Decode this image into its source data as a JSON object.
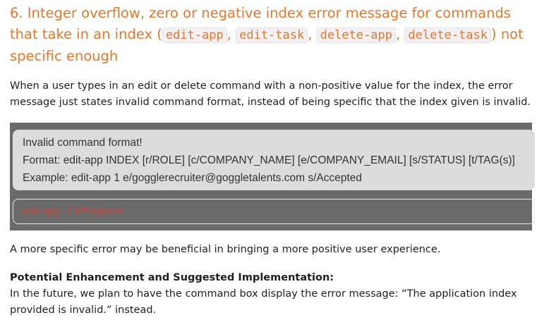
{
  "heading": {
    "prefix": "6. Integer overflow, zero or negative index error message for commands that take in an index (",
    "codes": [
      "edit-app",
      "edit-task",
      "delete-app",
      "delete-task"
    ],
    "separator": ", ",
    "suffix": ") not specific enough"
  },
  "description": "When a user types in an edit or delete command with a non-positive value for the index, the error message just states invalid command format, instead of being specific that the index given is invalid.",
  "screenshot": {
    "result_lines": [
      "Invalid command format!",
      "Format: edit-app INDEX [r/ROLE] [c/COMPANY_NAME] [e/COMPANY_EMAIL] [s/STATUS] [t/TAG(s)]",
      "Example: edit-app 1 e/gogglerecruiter@goggletalents.com s/Accepted"
    ],
    "command_input": "edit-app -1 r/Engineer",
    "colors": {
      "background": "#6a6a6a",
      "result_box": "#dcdcdc",
      "error_text": "#c2473e"
    }
  },
  "benefit": "A more specific error may be beneficial in bringing a more positive user experience.",
  "enhancement": {
    "title": "Potential Enhancement and Suggested Implementation:",
    "body": "In the future, we plan to have the command box display the error message: “The application index provided is invalid.” instead."
  },
  "colors": {
    "heading": "#e0792b"
  }
}
